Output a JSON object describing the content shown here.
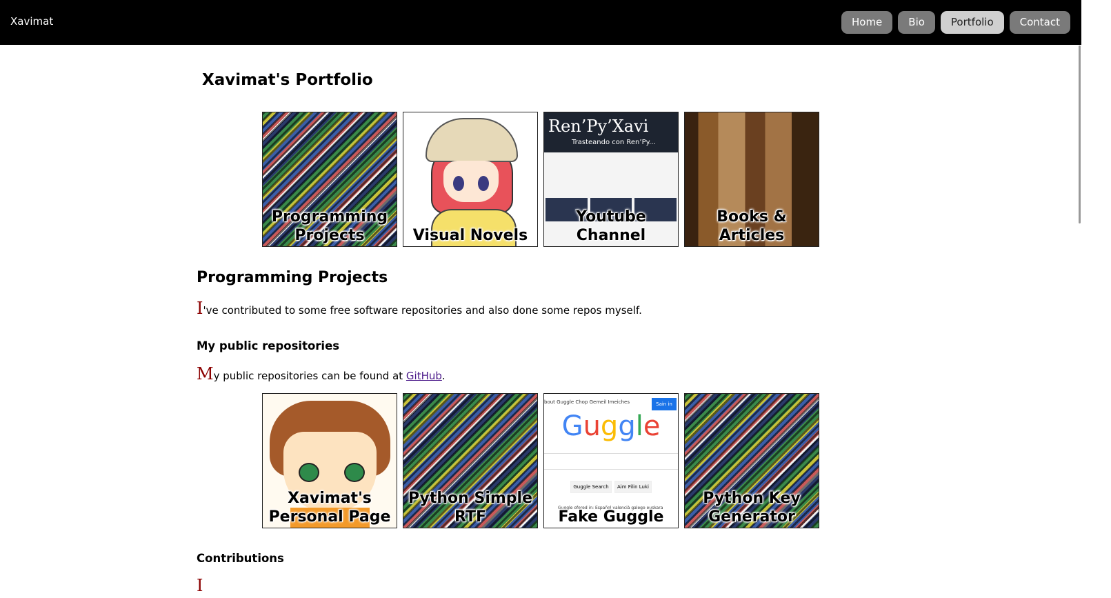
{
  "header": {
    "brand": "Xavimat",
    "nav": [
      "Home",
      "Bio",
      "Portfolio",
      "Contact"
    ],
    "active_nav": "Portfolio"
  },
  "page_title": "Xavimat's Portfolio",
  "categories": [
    {
      "label_line1": "Programming",
      "label_line2": "Projects"
    },
    {
      "label_line1": "Visual Novels",
      "label_line2": ""
    },
    {
      "label_line1": "Youtube Channel",
      "label_line2": ""
    },
    {
      "label_line1": "Books & Articles",
      "label_line2": ""
    }
  ],
  "youtube_thumb": {
    "title": "Ren’Py’Xavi",
    "subtitle": "Trasteando con Ren’Py..."
  },
  "programming": {
    "heading": "Programming Projects",
    "intro_cap": "I",
    "intro_rest": "'ve contributed to some free software repositories and also done some repos myself.",
    "public_heading": "My public repositories",
    "public_cap": "M",
    "public_pre": "y public repositories can be found at ",
    "public_link": "GitHub",
    "public_post": ".",
    "contributions_heading": "Contributions",
    "contributions_cap": "I"
  },
  "repos": [
    {
      "label_line1": "Xavimat's",
      "label_line2": "Personal Page"
    },
    {
      "label_line1": "Python Simple",
      "label_line2": "RTF"
    },
    {
      "label_line1": "Fake Guggle",
      "label_line2": ""
    },
    {
      "label_line1": "Python Key",
      "label_line2": "Generator"
    }
  ],
  "guggle_thumb": {
    "logo": "Guggle",
    "sign_in": "Sain in",
    "top_links": "bout Guggle    Chop          Gemeil   Imeiches",
    "btn_search": "Guggle Search",
    "btn_lucky": "Aim Filin Luki",
    "offered": "Guggle ofered in:  Español  valencià  galego  euskara"
  }
}
